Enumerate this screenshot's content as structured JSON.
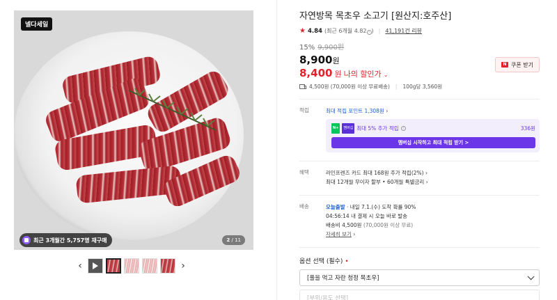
{
  "gallery": {
    "brand_logo": "넬다세일",
    "rebuy_badge": "최근 3개월간 5,757명 재구매",
    "page_current": "2",
    "page_total": " / 11",
    "thumbnails": [
      "video-thumb",
      "meat-thumb",
      "meat-thumb",
      "meat-thumb",
      "meat-thumb"
    ]
  },
  "product": {
    "title": "자연방목 목초우 소고기 [원산지:호주산]",
    "rating": "4.84",
    "rating_sub": "(최근 6개월 4.82",
    "reviews": "41,191건 리뷰",
    "discount_rate": "15%",
    "original_price": "9,900원",
    "sale_price": "8,900",
    "my_price": "8,400",
    "won": "원",
    "my_price_label": "나의 할인가",
    "coupon_button": "쿠폰 받기",
    "shipping_info": "4,500원 (70,000원 이상 무료배송)",
    "unit_price": "100g당 3,560원"
  },
  "points": {
    "label": "적립",
    "max_points": "최대 적립 포인트 1,308원",
    "npay_text": "최대 5% 추가 적립",
    "npay_amount": "336원",
    "membership_button": "멤버십 시작하고 최대 적립 받기 >"
  },
  "benefits": {
    "label": "혜택",
    "line1": "라인프렌즈 카드 최대 168원 추가 적립(2%)",
    "line2": "최대 12개월 무이자 할부 • 60개월 특별금리"
  },
  "delivery": {
    "label": "배송",
    "today": "오늘출발",
    "arrival": " · 내일 7.1.(수) 도착 확률 90%",
    "countdown": "04:56:14  내 결제 시 오늘 바로 발송",
    "fee_main": "배송비 4,500원",
    "fee_sub": " (70,000원 이상 무료)",
    "detail_link": "자세히 보기"
  },
  "options": {
    "title": "옵션 선택 (필수)",
    "required_mark": "•",
    "select1": "[풀을 먹고 자란 청정 목초우]",
    "select2": "[부위/용도 선택]"
  },
  "colors": {
    "accent_red": "#e4202d",
    "npay_purple": "#6b35e8",
    "link_blue": "#1a5fd8"
  }
}
